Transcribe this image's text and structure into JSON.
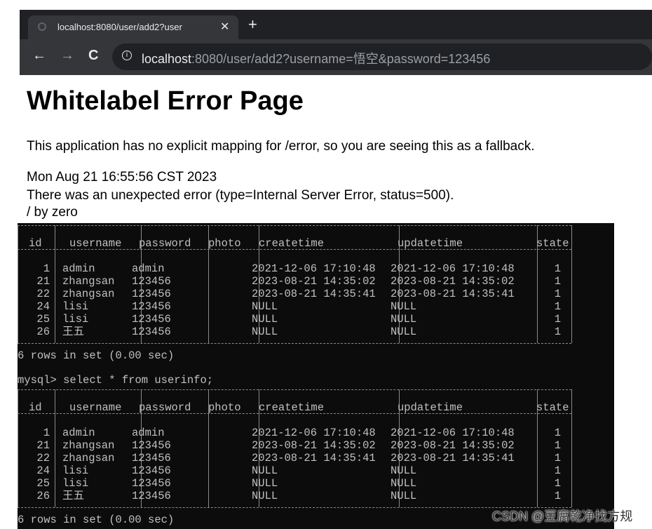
{
  "browser": {
    "tab_title": "localhost:8080/user/add2?user",
    "new_tab_label": "+",
    "close_label": "✕",
    "back_label": "←",
    "forward_label": "→",
    "reload_label": "C",
    "info_label": "i",
    "url_host": "localhost",
    "url_rest": ":8080/user/add2?username=悟空&password=123456"
  },
  "page": {
    "heading": "Whitelabel Error Page",
    "message": "This application has no explicit mapping for /error, so you are seeing this as a fallback.",
    "timestamp": "Mon Aug 21 16:55:56 CST 2023",
    "error_line": "There was an unexpected error (type=Internal Server Error, status=500).",
    "error_detail": "/ by zero"
  },
  "terminal": {
    "columns": [
      "id",
      "username",
      "password",
      "photo",
      "createtime",
      "updatetime",
      "state"
    ],
    "rows": [
      [
        "1",
        "admin",
        "admin",
        "",
        "2021-12-06 17:10:48",
        "2021-12-06 17:10:48",
        "1"
      ],
      [
        "21",
        "zhangsan",
        "123456",
        "",
        "2023-08-21 14:35:02",
        "2023-08-21 14:35:02",
        "1"
      ],
      [
        "22",
        "zhangsan",
        "123456",
        "",
        "2023-08-21 14:35:41",
        "2023-08-21 14:35:41",
        "1"
      ],
      [
        "24",
        "lisi",
        "123456",
        "",
        "NULL",
        "NULL",
        "1"
      ],
      [
        "25",
        "lisi",
        "123456",
        "",
        "NULL",
        "NULL",
        "1"
      ],
      [
        "26",
        "王五",
        "123456",
        "",
        "NULL",
        "NULL",
        "1"
      ]
    ],
    "rows_summary": "6 rows in set (0.00 sec)",
    "prompt": "mysql>",
    "command": "select * from userinfo;"
  },
  "watermark": "CSDN @豆腐乾净找方规"
}
